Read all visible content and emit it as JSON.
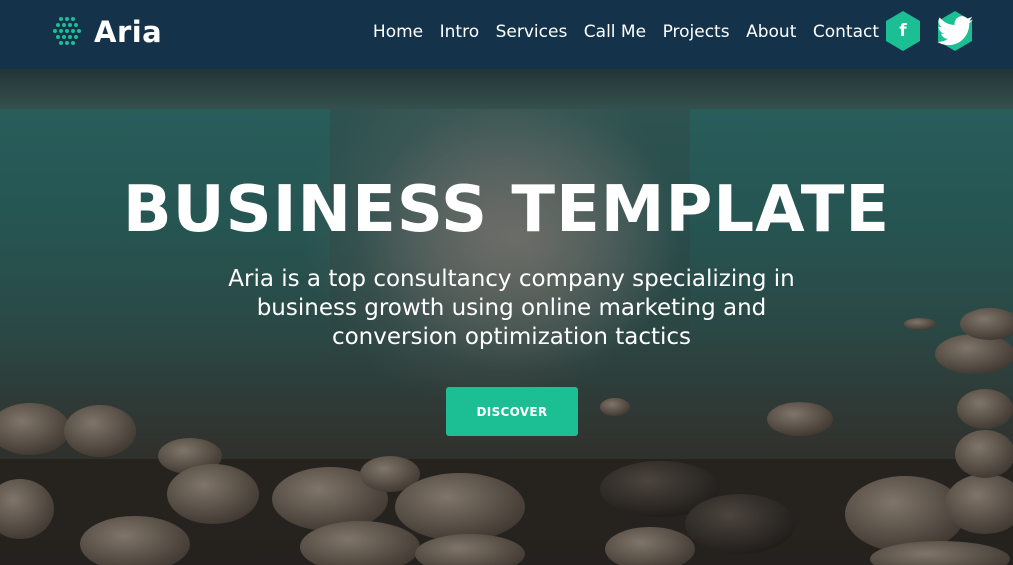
{
  "brand": {
    "name": "Aria",
    "icon": "dotted-hexagon-logo-icon",
    "accent": "#1cbf94"
  },
  "nav": {
    "items": [
      "Home",
      "Intro",
      "Services",
      "Call Me",
      "Projects",
      "About",
      "Contact"
    ]
  },
  "social": [
    {
      "name": "facebook",
      "icon": "facebook-icon",
      "glyph": "f"
    },
    {
      "name": "twitter",
      "icon": "twitter-icon",
      "glyph": "🐦"
    }
  ],
  "hero": {
    "title": "BUSINESS TEMPLATE",
    "subtitle": "Aria is a top consultancy company specializing in business growth using online marketing and conversion optimization tactics",
    "cta_label": "DISCOVER"
  },
  "colors": {
    "header_bg": "#14334a",
    "accent": "#1cbf94",
    "text": "#ffffff"
  }
}
